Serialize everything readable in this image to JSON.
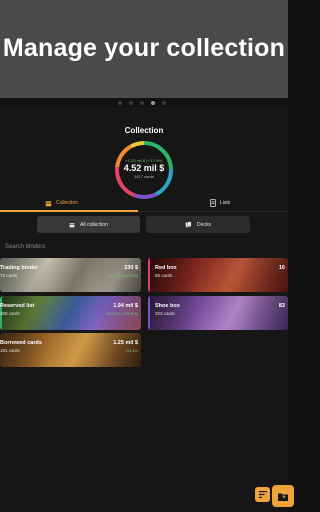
{
  "banner": {
    "title": "Manage your collection"
  },
  "collection": {
    "title": "Collection",
    "change": "+1.23 mil $ (+37.4%)",
    "value": "4.52 mil $",
    "card_count": "1417 cards"
  },
  "tabs": [
    {
      "label": "Collection",
      "icon": "box-icon",
      "active": true
    },
    {
      "label": "Lists",
      "icon": "list-icon",
      "active": false
    }
  ],
  "segments": [
    {
      "label": "All collection",
      "icon": "box-icon",
      "active": true
    },
    {
      "label": "Decks",
      "icon": "cards-icon",
      "active": false
    }
  ],
  "search": {
    "placeholder": "Search binders"
  },
  "binders": [
    {
      "name": "Trading binder",
      "count": "79 cards",
      "value": "230 $",
      "change": "+57.00 (+33.0%)"
    },
    {
      "name": "Reserved list",
      "count": "359 cards",
      "value": "1.94 mil $",
      "change": "+404.00 (+25.0%)"
    },
    {
      "name": "Borrowed cards",
      "count": "191 cards",
      "value": "1.25 mil $",
      "change": "+44.4%"
    },
    {
      "name": "Red box",
      "count": "85 cards",
      "value": "16",
      "change": ""
    },
    {
      "name": "Shoe box",
      "count": "323 cards",
      "value": "83",
      "change": ""
    }
  ],
  "colors": {
    "accent": "#f0a33a",
    "positive": "#6ac46a"
  }
}
